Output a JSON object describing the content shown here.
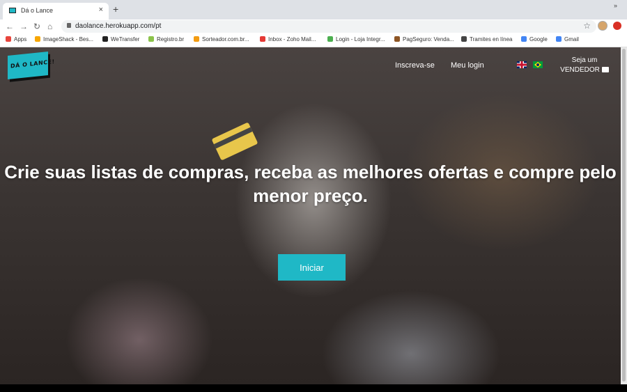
{
  "browser": {
    "tab_title": "Dá o Lance",
    "tab_close": "×",
    "new_tab": "+",
    "back": "←",
    "forward": "→",
    "reload": "↻",
    "home": "⌂",
    "url": "daolance.herokuapp.com/pt",
    "star": "☆",
    "bookmarks": [
      {
        "label": "Apps",
        "icon": "apps-grid-icon",
        "color": "#e8453c"
      },
      {
        "label": "ImageShack - Bes...",
        "icon": "imageshack-icon",
        "color": "#f7a600"
      },
      {
        "label": "WeTransfer",
        "icon": "wetransfer-icon",
        "color": "#222222"
      },
      {
        "label": "Registro.br",
        "icon": "registro-icon",
        "color": "#8bc34a"
      },
      {
        "label": "Sorteador.com.br...",
        "icon": "sorteador-icon",
        "color": "#f39c12"
      },
      {
        "label": "Inbox - Zoho Mail...",
        "icon": "zoho-mail-icon",
        "color": "#e53935"
      },
      {
        "label": "Login - Loja Integr...",
        "icon": "loja-integrada-icon",
        "color": "#4caf50"
      },
      {
        "label": "PagSeguro: Venda...",
        "icon": "pagseguro-icon",
        "color": "#8d5524"
      },
      {
        "label": "Tramites en línea",
        "icon": "globe-icon",
        "color": "#444444"
      },
      {
        "label": "Google",
        "icon": "google-icon",
        "color": "#4285f4"
      },
      {
        "label": "Gmail",
        "icon": "google-icon",
        "color": "#4285f4"
      }
    ],
    "more_bookmarks": "»"
  },
  "site": {
    "logo_text": "DÁ O LANCE!",
    "nav": {
      "signup": "Inscreva-se",
      "login": "Meu login",
      "seller_line1": "Seja um",
      "seller_line2": "VENDEDOR"
    },
    "languages": [
      "english-flag-icon",
      "brazil-flag-icon"
    ],
    "hero_title": "Crie suas listas de compras, receba as melhores ofertas e compre pelo menor preço.",
    "cta_label": "Iniciar"
  },
  "colors": {
    "brand_teal": "#1fb8c6",
    "tab_bar": "#dee1e6"
  }
}
